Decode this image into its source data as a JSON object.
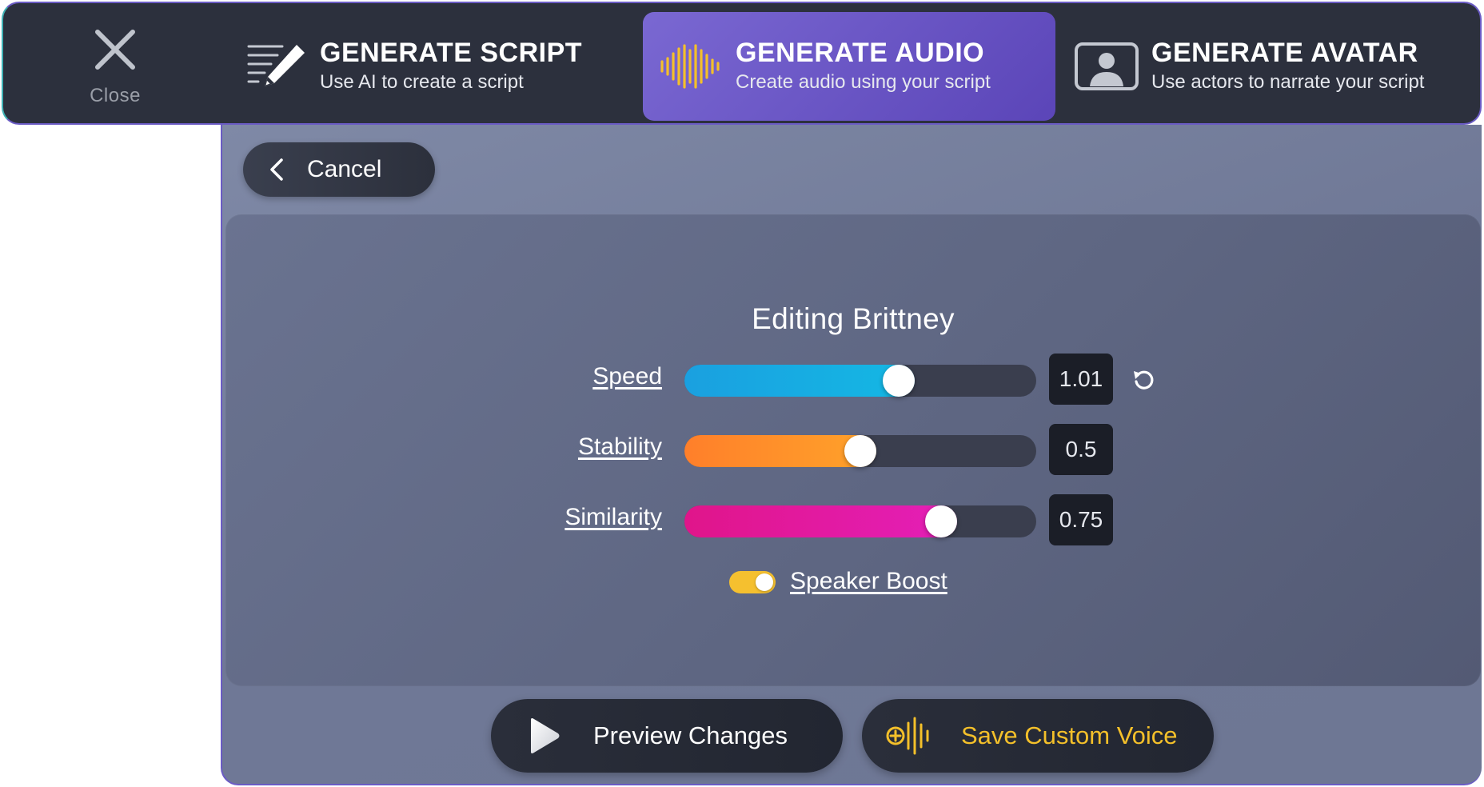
{
  "header": {
    "close_label": "Close",
    "tabs": [
      {
        "id": "script",
        "title": "GENERATE SCRIPT",
        "subtitle": "Use AI to create a script",
        "icon": "pen-lines-icon",
        "active": false
      },
      {
        "id": "audio",
        "title": "GENERATE AUDIO",
        "subtitle": "Create audio using your script",
        "icon": "audio-wave-icon",
        "active": true
      },
      {
        "id": "avatar",
        "title": "GENERATE AVATAR",
        "subtitle": "Use actors to narrate your script",
        "icon": "avatar-frame-icon",
        "active": false
      }
    ]
  },
  "panel": {
    "cancel_label": "Cancel",
    "editor_title": "Editing Brittney",
    "sliders": [
      {
        "label": "Speed",
        "value": "1.01",
        "fill_fraction": 0.61,
        "colors": [
          "#1aa0e0",
          "#14b8e4"
        ],
        "has_reset": true
      },
      {
        "label": "Stability",
        "value": "0.5",
        "fill_fraction": 0.5,
        "colors": [
          "#ff7f2a",
          "#ffa32a"
        ],
        "has_reset": false
      },
      {
        "label": "Similarity",
        "value": "0.75",
        "fill_fraction": 0.73,
        "colors": [
          "#e0158a",
          "#e41fb8"
        ],
        "has_reset": false
      }
    ],
    "speaker_boost": {
      "label": "Speaker Boost",
      "enabled": true
    },
    "preview_label": "Preview Changes",
    "save_label": "Save Custom Voice"
  },
  "colors": {
    "accent": "#6b58c8",
    "highlight": "#f4c02a",
    "topbar": "#2c303d"
  }
}
